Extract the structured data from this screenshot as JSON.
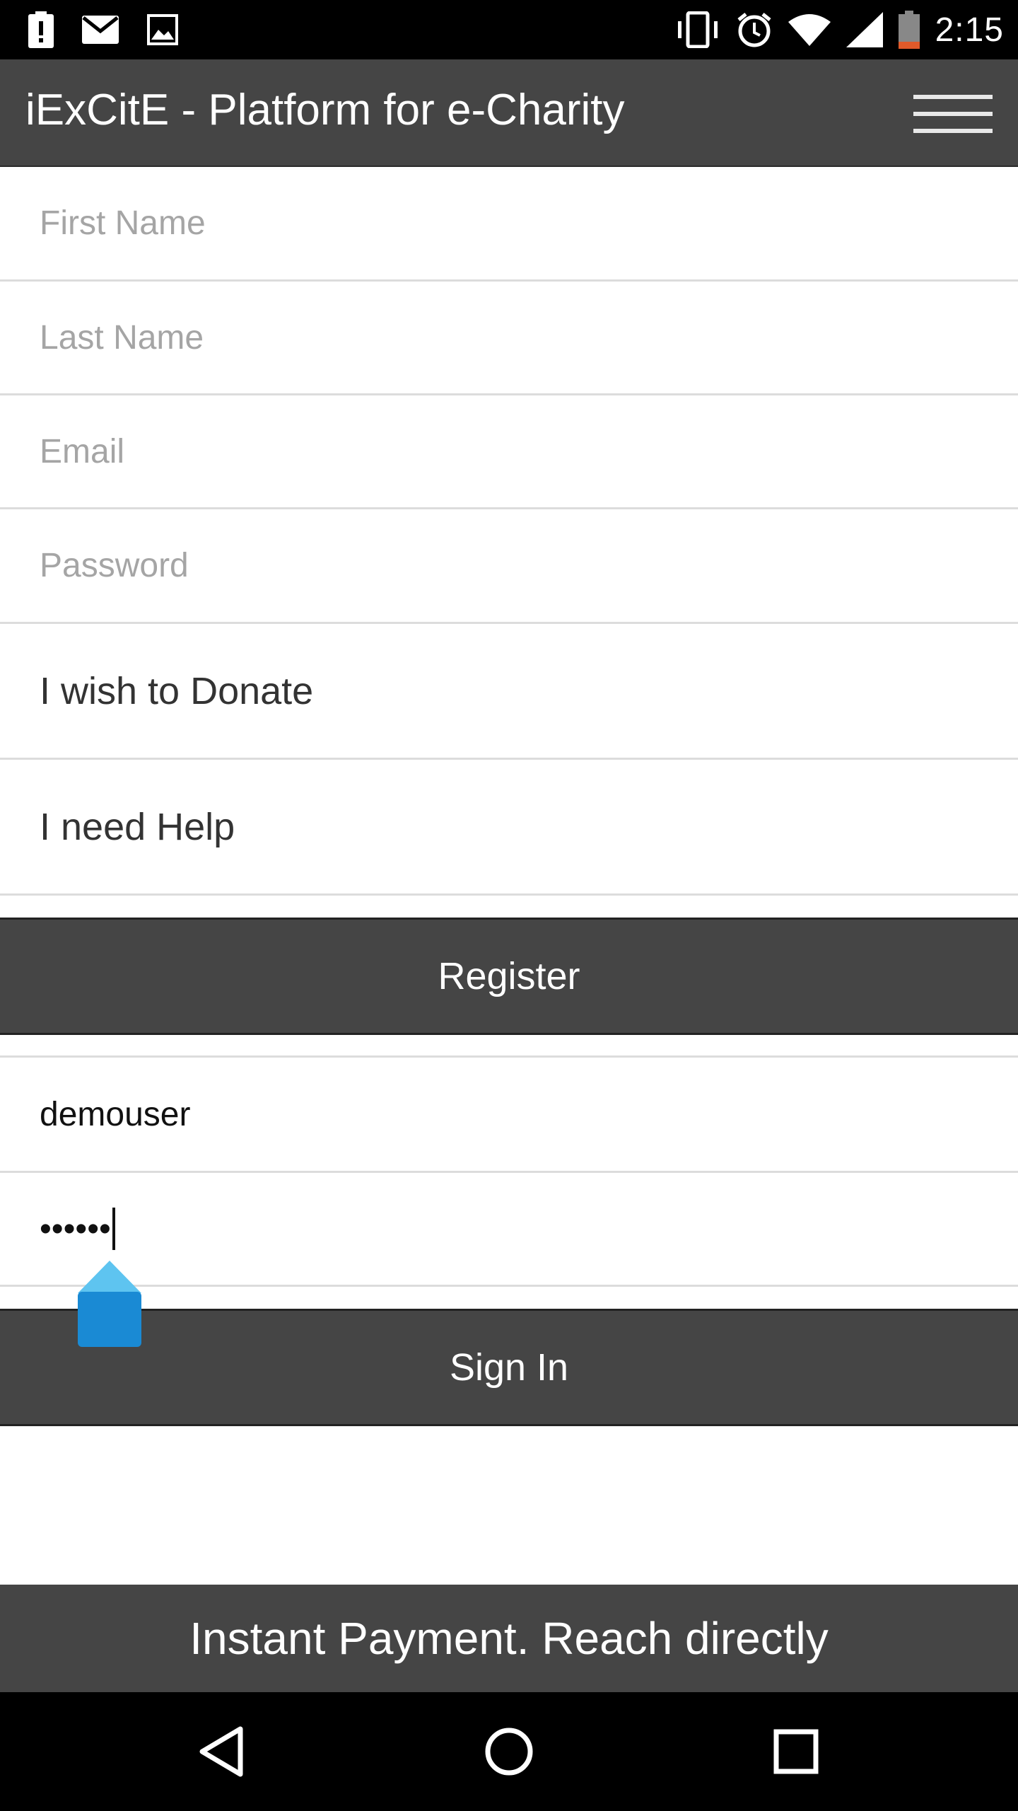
{
  "status_bar": {
    "time": "2:15",
    "left_icons": [
      "alert-icon",
      "mail-icon",
      "image-icon"
    ],
    "right_icons": [
      "vibrate-icon",
      "alarm-icon",
      "wifi-icon",
      "signal-icon",
      "battery-icon"
    ]
  },
  "app_bar": {
    "title": "iExCitE - Platform for e-Charity",
    "menu_icon": "hamburger-menu-icon"
  },
  "register_form": {
    "first_name_placeholder": "First Name",
    "last_name_placeholder": "Last Name",
    "email_placeholder": "Email",
    "password_placeholder": "Password",
    "option_donate": "I wish to Donate",
    "option_help": "I need Help",
    "register_label": "Register"
  },
  "signin_form": {
    "username_value": "demouser",
    "password_value": "••••••",
    "signin_label": "Sign In"
  },
  "footer": {
    "tagline": "Instant Payment. Reach directly"
  },
  "nav_bar": {
    "icons": [
      "back-icon",
      "home-icon",
      "recents-icon"
    ]
  },
  "colors": {
    "bar": "#454545",
    "accent_handle": "#1a8ad4",
    "divider": "#dcdcdc"
  }
}
